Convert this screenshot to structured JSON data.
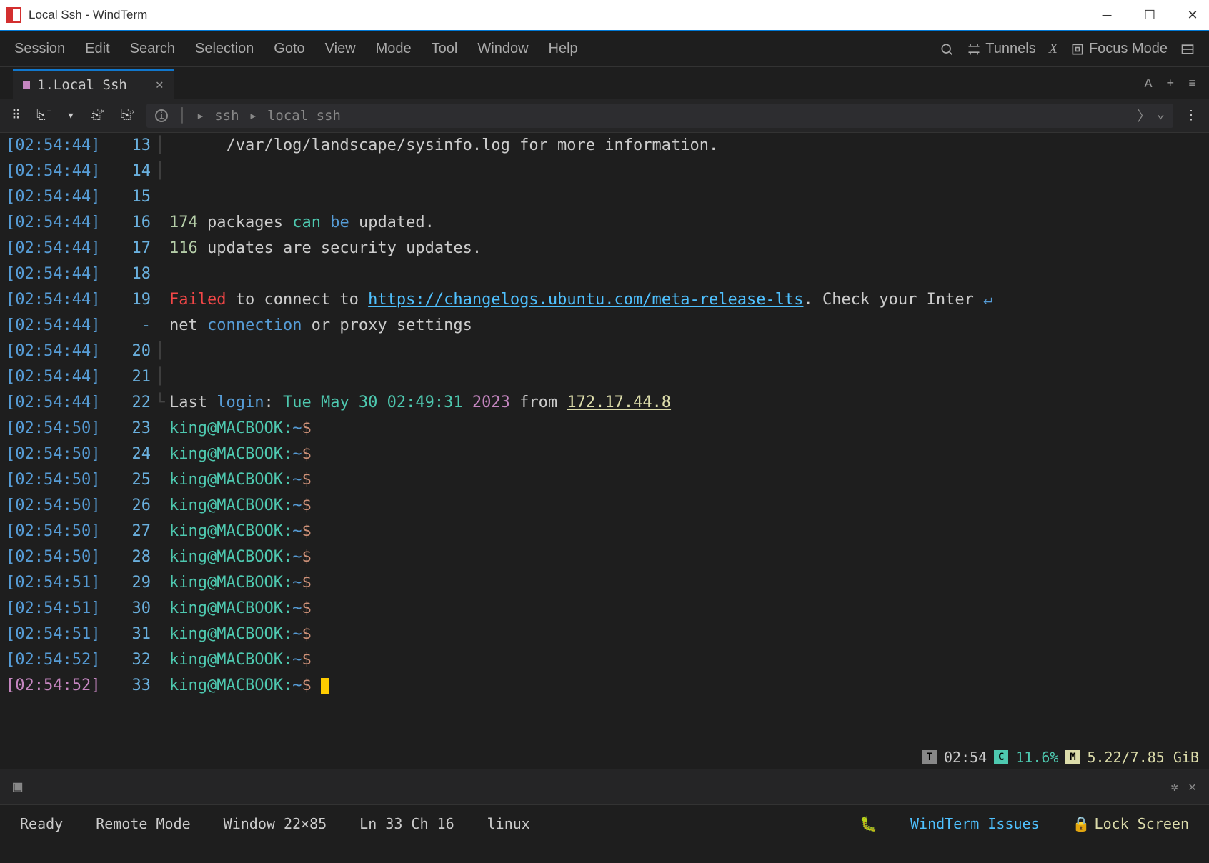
{
  "window": {
    "title": "Local Ssh - WindTerm"
  },
  "menubar": {
    "items": [
      "Session",
      "Edit",
      "Search",
      "Selection",
      "Goto",
      "View",
      "Mode",
      "Tool",
      "Window",
      "Help"
    ],
    "tunnels": "Tunnels",
    "focus_mode": "Focus Mode"
  },
  "tab": {
    "label": "1.Local Ssh"
  },
  "breadcrumb": {
    "seg1": "ssh",
    "seg2": "local ssh"
  },
  "terminal": {
    "lines": [
      {
        "ts": "[02:54:44]",
        "ln": "13",
        "gutter": "│",
        "type": "text",
        "segments": [
          {
            "t": "      /var/log/landscape/sysinfo.log for more information.",
            "c": ""
          }
        ]
      },
      {
        "ts": "[02:54:44]",
        "ln": "14",
        "gutter": "│",
        "type": "blank"
      },
      {
        "ts": "[02:54:44]",
        "ln": "15",
        "gutter": "",
        "type": "blank"
      },
      {
        "ts": "[02:54:44]",
        "ln": "16",
        "gutter": "",
        "type": "pkg1",
        "n": "174",
        "a": " packages ",
        "kw": "can",
        "b": " ",
        "kw2": "be",
        "c": " updated."
      },
      {
        "ts": "[02:54:44]",
        "ln": "17",
        "gutter": "",
        "type": "pkg2",
        "n": "116",
        "a": " updates are security updates."
      },
      {
        "ts": "[02:54:44]",
        "ln": "18",
        "gutter": "",
        "type": "blank"
      },
      {
        "ts": "[02:54:44]",
        "ln": "19",
        "gutter": "",
        "type": "failed",
        "fail": "Failed",
        "a": " to connect to ",
        "url": "https://changelogs.ubuntu.com/meta-release-lts",
        "b": ". Check your Inter ",
        "icon": "↵"
      },
      {
        "ts": "[02:54:44]",
        "ln": "-",
        "gutter": "",
        "type": "conn",
        "a": "net ",
        "kw": "connection",
        "b": " or proxy settings"
      },
      {
        "ts": "[02:54:44]",
        "ln": "20",
        "gutter": "│",
        "type": "blank"
      },
      {
        "ts": "[02:54:44]",
        "ln": "21",
        "gutter": "│",
        "type": "blank"
      },
      {
        "ts": "[02:54:44]",
        "ln": "22",
        "gutter": "└",
        "type": "login",
        "a": "Last ",
        "kw": "login",
        "b": ": ",
        "date": "Tue May 30 02:49:31",
        "year": " 2023",
        "c": " from ",
        "ip": "172.17.44.8"
      },
      {
        "ts": "[02:54:50]",
        "ln": "23",
        "gutter": "",
        "type": "prompt"
      },
      {
        "ts": "[02:54:50]",
        "ln": "24",
        "gutter": "",
        "type": "prompt"
      },
      {
        "ts": "[02:54:50]",
        "ln": "25",
        "gutter": "",
        "type": "prompt"
      },
      {
        "ts": "[02:54:50]",
        "ln": "26",
        "gutter": "",
        "type": "prompt"
      },
      {
        "ts": "[02:54:50]",
        "ln": "27",
        "gutter": "",
        "type": "prompt"
      },
      {
        "ts": "[02:54:50]",
        "ln": "28",
        "gutter": "",
        "type": "prompt"
      },
      {
        "ts": "[02:54:51]",
        "ln": "29",
        "gutter": "",
        "type": "prompt"
      },
      {
        "ts": "[02:54:51]",
        "ln": "30",
        "gutter": "",
        "type": "prompt"
      },
      {
        "ts": "[02:54:51]",
        "ln": "31",
        "gutter": "",
        "type": "prompt"
      },
      {
        "ts": "[02:54:52]",
        "ln": "32",
        "gutter": "",
        "type": "prompt"
      },
      {
        "ts": "[02:54:52]",
        "ln": "33",
        "gutter": "",
        "type": "prompt",
        "active": true,
        "cursor": true
      }
    ],
    "prompt": {
      "user": "king",
      "at": "@",
      "host": "MACBOOK",
      "colon": ":",
      "path": "~",
      "sym": "$"
    }
  },
  "status": {
    "time": "02:54",
    "cpu": "11.6%",
    "mem": "5.22/7.85 GiB"
  },
  "statusline": {
    "ready": "Ready",
    "remote_mode": "Remote Mode",
    "window_size": "Window 22×85",
    "cursor_pos": "Ln 33 Ch 16",
    "os": "linux",
    "issues": "WindTerm Issues",
    "lock": "Lock Screen"
  }
}
